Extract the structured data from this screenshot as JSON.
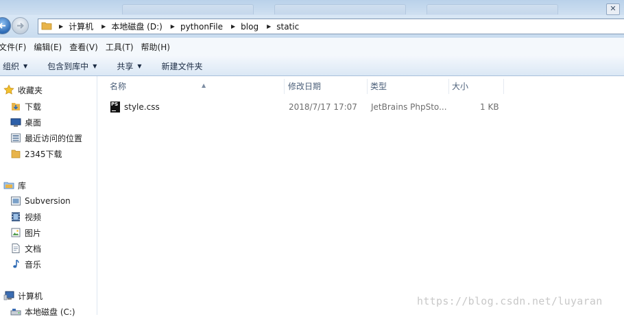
{
  "address": {
    "crumbs": [
      "计算机",
      "本地磁盘 (D:)",
      "pythonFile",
      "blog",
      "static"
    ]
  },
  "menubar": {
    "items": [
      "文件(F)",
      "编辑(E)",
      "查看(V)",
      "工具(T)",
      "帮助(H)"
    ]
  },
  "toolbar": {
    "organize": "组织",
    "include_in_library": "包含到库中",
    "share": "共享",
    "new_folder": "新建文件夹"
  },
  "sidebar": {
    "favorites": {
      "label": "收藏夹",
      "items": [
        "下载",
        "桌面",
        "最近访问的位置",
        "2345下载"
      ]
    },
    "libraries": {
      "label": "库",
      "items": [
        "Subversion",
        "视频",
        "图片",
        "文档",
        "音乐"
      ]
    },
    "computer": {
      "label": "计算机",
      "items": [
        "本地磁盘 (C:)"
      ]
    }
  },
  "columns": {
    "name": "名称",
    "modified": "修改日期",
    "type": "类型",
    "size": "大小"
  },
  "files": [
    {
      "icon_text": "PS",
      "name": "style.css",
      "modified": "2018/7/17 17:07",
      "type": "JetBrains PhpSto...",
      "size": "1 KB"
    }
  ],
  "watermark": "https://blog.csdn.net/luyaran",
  "colors": {
    "accent": "#2e6bb5",
    "folder": "#e8b44a",
    "toolbar_bg": "#dbe8f5"
  }
}
